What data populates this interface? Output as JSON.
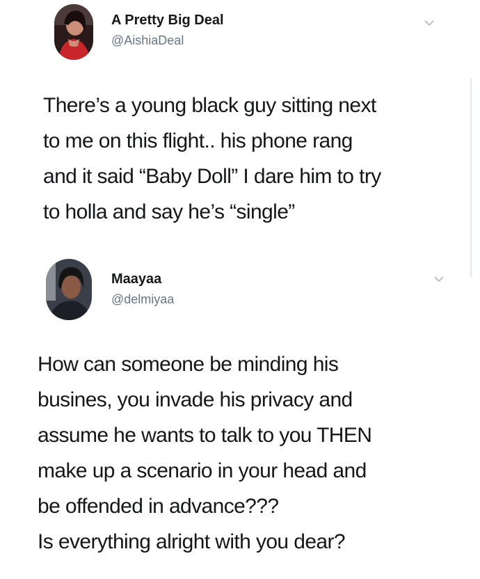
{
  "tweets": [
    {
      "display_name": "A Pretty Big Deal",
      "handle": "@AishiaDeal",
      "avatar_icon": "profile-photo-icon",
      "text_lines": [
        "There’s a young black guy sitting next",
        "to me on this flight.. his phone rang",
        "and it said “Baby Doll” I dare him to try",
        "to holla and say he’s “single”"
      ]
    },
    {
      "display_name": "Maayaa",
      "handle": "@delmiyaa",
      "avatar_icon": "profile-photo-icon",
      "text_lines": [
        "How can someone be minding his",
        "busines, you invade his privacy and",
        "assume he wants to talk to you THEN",
        "make up a scenario in your head and",
        "be offended in advance???",
        "Is everything alright with you dear?"
      ]
    }
  ],
  "colors": {
    "text": "#14171a",
    "secondary": "#657786",
    "background": "#ffffff"
  }
}
